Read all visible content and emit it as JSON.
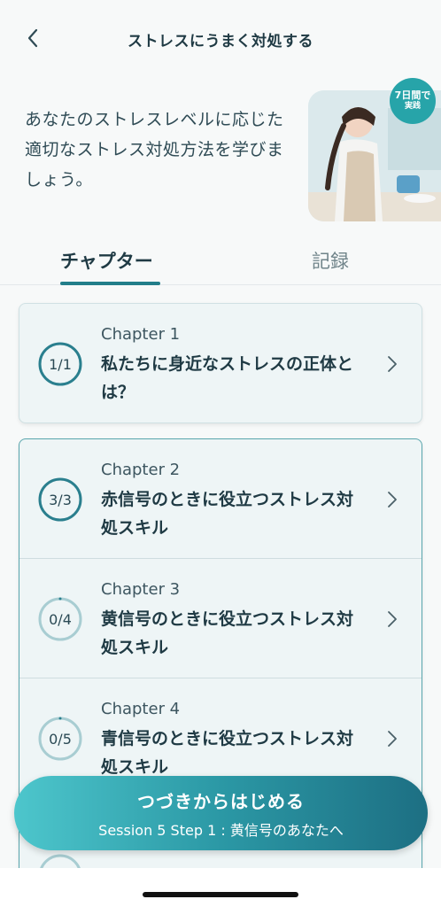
{
  "header": {
    "title": "ストレスにうまく対処する"
  },
  "intro": {
    "text": "あなたのストレスレベルに応じた適切なストレス対処方法を学びましょう。"
  },
  "hero": {
    "badge_line1": "7日間で",
    "badge_line2": "実践"
  },
  "tabs": [
    {
      "label": "チャプター",
      "active": true
    },
    {
      "label": "記録",
      "active": false
    }
  ],
  "chapters": [
    {
      "num": "Chapter 1",
      "title": "私たちに身近なストレスの正体とは？",
      "progress": "1/1",
      "fraction": 1.0
    },
    {
      "num": "Chapter 2",
      "title": "赤信号のときに役立つストレス対処スキル",
      "progress": "3/3",
      "fraction": 1.0
    },
    {
      "num": "Chapter 3",
      "title": "黄信号のときに役立つストレス対処スキル",
      "progress": "0/4",
      "fraction": 0
    },
    {
      "num": "Chapter 4",
      "title": "青信号のときに役立つストレス対処スキル",
      "progress": "0/5",
      "fraction": 0
    }
  ],
  "cta": {
    "title": "つづきからはじめる",
    "subtitle": "Session 5 Step 1 : 黄信号のあなたへ"
  },
  "colors": {
    "accent": "#227e8a",
    "ring_done": "#2a7f8e",
    "ring_todo": "#a8cdd2"
  }
}
